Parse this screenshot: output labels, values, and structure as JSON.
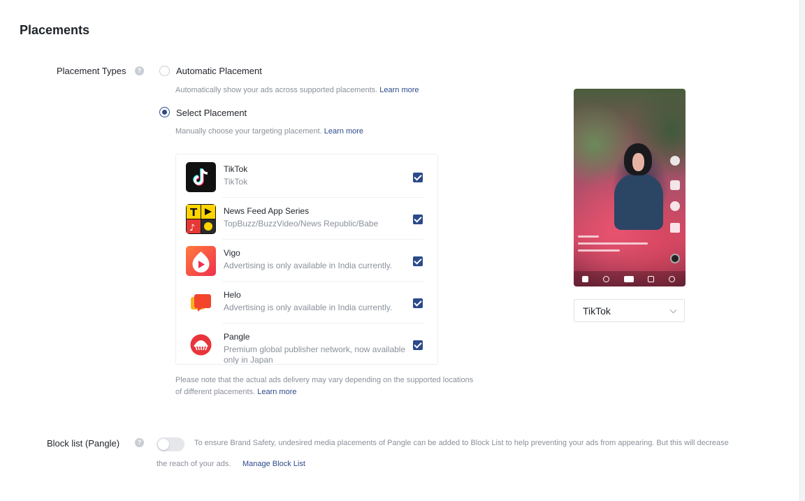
{
  "section_title": "Placements",
  "placement_types": {
    "label": "Placement Types",
    "help_icon": "question-icon",
    "options": [
      {
        "label": "Automatic Placement",
        "hint": "Automatically show your ads across supported placements.",
        "link": "Learn more",
        "selected": false
      },
      {
        "label": "Select Placement",
        "hint": "Manually choose your targeting placement.",
        "link": "Learn more",
        "selected": true
      }
    ]
  },
  "placements": [
    {
      "name": "TikTok",
      "desc": "TikTok",
      "icon": "tiktok-icon",
      "checked": true
    },
    {
      "name": "News Feed App Series",
      "desc": "TopBuzz/BuzzVideo/News Republic/Babe",
      "icon": "news-feed-icon",
      "checked": true
    },
    {
      "name": "Vigo",
      "desc": "Advertising is only available in India currently.",
      "icon": "vigo-icon",
      "checked": true
    },
    {
      "name": "Helo",
      "desc": "Advertising is only available in India currently.",
      "icon": "helo-icon",
      "checked": true
    },
    {
      "name": "Pangle",
      "desc": "Premium global publisher network, now available only in Japan",
      "icon": "pangle-icon",
      "checked": true
    }
  ],
  "note": {
    "text": "Please note that the actual ads delivery may vary depending on the supported locations of different placements.",
    "link": "Learn more"
  },
  "preview": {
    "selected": "TikTok"
  },
  "block_list": {
    "label": "Block list (Pangle)",
    "toggle_on": false,
    "text_line1": "To ensure Brand Safety, undesired media placements of Pangle can be added to Block List to help preventing your ads from appearing. But this will decrease",
    "text_line2": "the reach of your ads.",
    "link": "Manage Block List"
  },
  "colors": {
    "accent": "#2b4a8a",
    "muted": "#8a9099"
  }
}
